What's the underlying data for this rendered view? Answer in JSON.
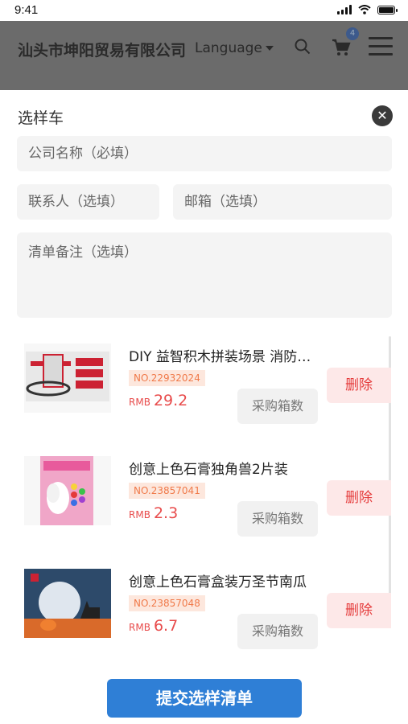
{
  "status": {
    "time": "9:41"
  },
  "header": {
    "company": "汕头市坤阳贸易有限公司",
    "language": "Language",
    "cart_count": "4"
  },
  "sheet": {
    "title": "选样车",
    "fields": {
      "company_placeholder": "公司名称（必填）",
      "contact_placeholder": "联系人（选填）",
      "email_placeholder": "邮箱（选填）",
      "note_placeholder": "清单备注（选填）"
    },
    "items": [
      {
        "title": "DIY 益智积木拼装场景 消防车站",
        "no": "NO.22932024",
        "currency": "RMB",
        "price": "29.2",
        "qty_label": "采购箱数",
        "delete_label": "删除"
      },
      {
        "title": "创意上色石膏独角兽2片装",
        "no": "NO.23857041",
        "currency": "RMB",
        "price": "2.3",
        "qty_label": "采购箱数",
        "delete_label": "删除"
      },
      {
        "title": "创意上色石膏盒装万圣节南瓜",
        "no": "NO.23857048",
        "currency": "RMB",
        "price": "6.7",
        "qty_label": "采购箱数",
        "delete_label": "删除"
      }
    ],
    "submit_label": "提交选样清单"
  },
  "colors": {
    "primary": "#2f7fd6",
    "danger": "#e53c3c",
    "tag": "#f07a4a"
  }
}
